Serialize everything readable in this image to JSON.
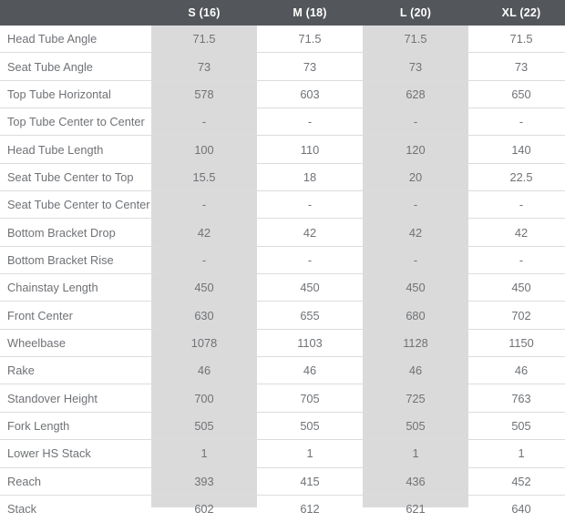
{
  "table": {
    "corner_label": "",
    "columns": [
      {
        "label": "S (16)",
        "key": "S",
        "striped": true
      },
      {
        "label": "M (18)",
        "key": "M",
        "striped": false
      },
      {
        "label": "L (20)",
        "key": "L",
        "striped": true
      },
      {
        "label": "XL (22)",
        "key": "XL",
        "striped": false
      }
    ],
    "rows": [
      {
        "label": "Head Tube Angle",
        "values": [
          "71.5",
          "71.5",
          "71.5",
          "71.5"
        ]
      },
      {
        "label": "Seat Tube Angle",
        "values": [
          "73",
          "73",
          "73",
          "73"
        ]
      },
      {
        "label": "Top Tube Horizontal",
        "values": [
          "578",
          "603",
          "628",
          "650"
        ]
      },
      {
        "label": "Top Tube Center to Center",
        "values": [
          "-",
          "-",
          "-",
          "-"
        ]
      },
      {
        "label": "Head Tube Length",
        "values": [
          "100",
          "110",
          "120",
          "140"
        ]
      },
      {
        "label": "Seat Tube Center to Top",
        "values": [
          "15.5",
          "18",
          "20",
          "22.5"
        ]
      },
      {
        "label": "Seat Tube Center to Center",
        "values": [
          "-",
          "-",
          "-",
          "-"
        ]
      },
      {
        "label": "Bottom Bracket Drop",
        "values": [
          "42",
          "42",
          "42",
          "42"
        ]
      },
      {
        "label": "Bottom Bracket Rise",
        "values": [
          "-",
          "-",
          "-",
          "-"
        ]
      },
      {
        "label": "Chainstay Length",
        "values": [
          "450",
          "450",
          "450",
          "450"
        ]
      },
      {
        "label": "Front Center",
        "values": [
          "630",
          "655",
          "680",
          "702"
        ]
      },
      {
        "label": "Wheelbase",
        "values": [
          "1078",
          "1103",
          "1128",
          "1150"
        ]
      },
      {
        "label": "Rake",
        "values": [
          "46",
          "46",
          "46",
          "46"
        ]
      },
      {
        "label": "Standover Height",
        "values": [
          "700",
          "705",
          "725",
          "763"
        ]
      },
      {
        "label": "Fork Length",
        "values": [
          "505",
          "505",
          "505",
          "505"
        ]
      },
      {
        "label": "Lower HS Stack",
        "values": [
          "1",
          "1",
          "1",
          "1"
        ]
      },
      {
        "label": "Reach",
        "values": [
          "393",
          "415",
          "436",
          "452"
        ]
      },
      {
        "label": "Stack",
        "values": [
          "602",
          "612",
          "621",
          "640"
        ]
      }
    ]
  },
  "colors": {
    "header_background": "#53565a",
    "header_text": "#ffffff",
    "stripe_background": "#dadada",
    "row_text": "#6f7276",
    "row_divider": "#dcdcdc",
    "page_background": "#ffffff"
  }
}
